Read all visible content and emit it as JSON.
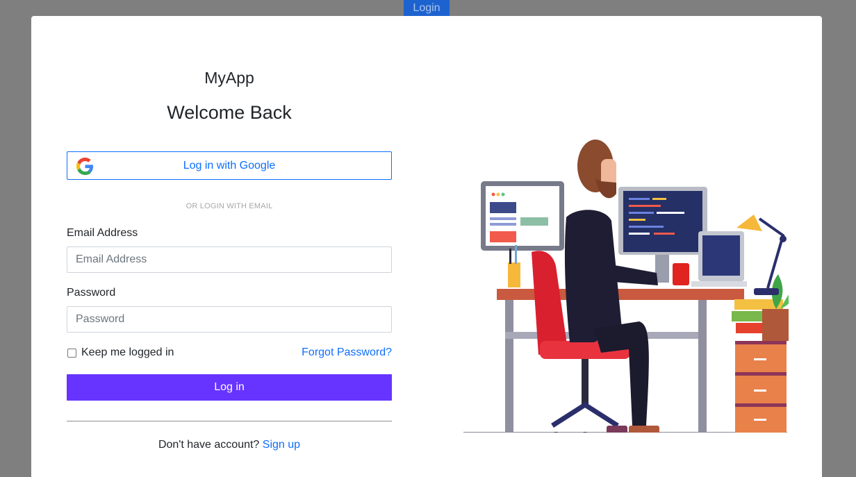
{
  "background_button": {
    "label": "Login"
  },
  "modal": {
    "app_name": "MyApp",
    "heading": "Welcome Back",
    "google_button": {
      "label": "Log in with Google",
      "icon": "google-icon"
    },
    "divider_text": "OR LOGIN WITH EMAIL",
    "email": {
      "label": "Email Address",
      "placeholder": "Email Address",
      "value": ""
    },
    "password": {
      "label": "Password",
      "placeholder": "Password",
      "value": ""
    },
    "remember_me": {
      "label": "Keep me logged in",
      "checked": false
    },
    "forgot_password": "Forgot Password?",
    "login_button": "Log in",
    "signup_prompt": "Don't have account?",
    "signup_link": "Sign up",
    "illustration": "developer-at-desk-illustration"
  },
  "colors": {
    "primary_link": "#0d6efd",
    "login_button": "#6734ff",
    "overlay": "#7f7f7f"
  }
}
